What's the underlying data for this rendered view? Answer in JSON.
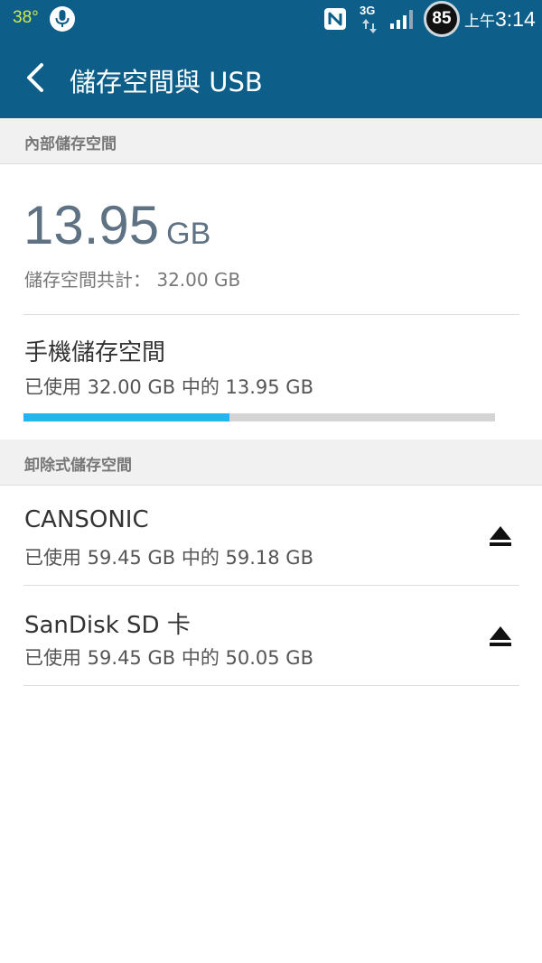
{
  "status_bar": {
    "temperature": "38°",
    "network_type": "3G",
    "badge_count": "85",
    "time_period": "上午",
    "time": "3:14",
    "icons": [
      "mic-icon",
      "nfc-icon",
      "data-arrows-icon",
      "signal-icon"
    ]
  },
  "app_bar": {
    "title": "儲存空間與 USB",
    "back_icon": "chevron-left-icon"
  },
  "internal": {
    "header": "內部儲存空間",
    "used_value": "13.95",
    "used_unit": "GB",
    "total_label": "儲存空間共計： 32.00 GB",
    "phone_storage": {
      "title": "手機儲存空間",
      "subtitle": "已使用 32.00 GB 中的 13.95 GB",
      "used_fraction": 0.436
    }
  },
  "removable": {
    "header": "卸除式儲存空間",
    "items": [
      {
        "title": "CANSONIC",
        "subtitle": "已使用 59.45 GB 中的 59.18 GB",
        "action_icon": "eject-icon"
      },
      {
        "title": "SanDisk SD 卡",
        "subtitle": "已使用 59.45 GB 中的 50.05 GB",
        "action_icon": "eject-icon"
      }
    ]
  },
  "colors": {
    "app_bar": "#0d5f8a",
    "progress_fill": "#21b6ec",
    "progress_track": "#d4d4d4",
    "big_value": "#5f7283"
  }
}
